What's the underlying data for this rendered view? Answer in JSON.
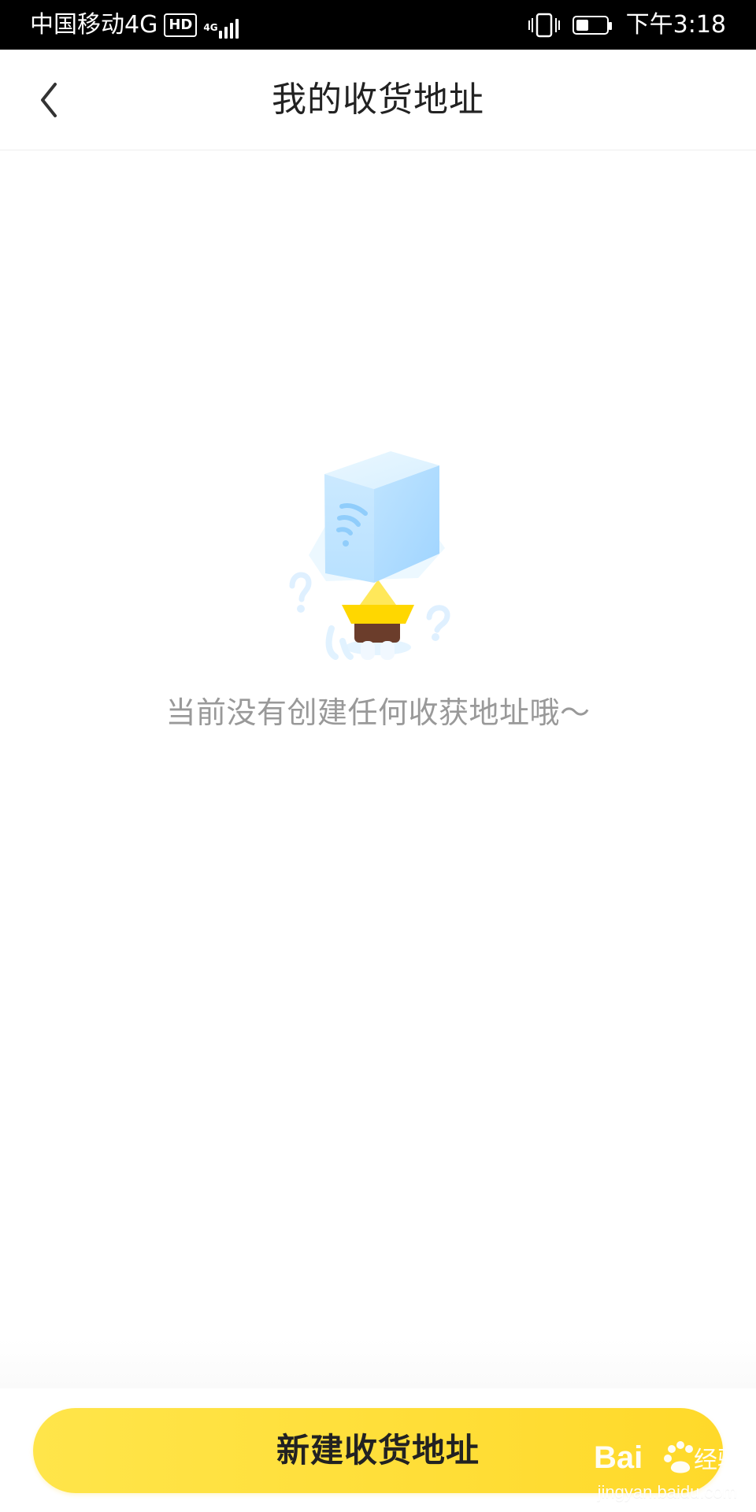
{
  "status_bar": {
    "carrier": "中国移动4G",
    "hd_badge": "HD",
    "network_tag": "4G",
    "time": "下午3:18",
    "battery_percent": 30
  },
  "nav": {
    "back_icon": "chevron-left-icon",
    "title": "我的收货地址"
  },
  "empty_state": {
    "illustration": "empty-box-character-icon",
    "message": "当前没有创建任何收获地址哦～"
  },
  "bottom": {
    "primary_button_label": "新建收货地址"
  },
  "watermark": {
    "logo_text": "Baidu经验",
    "url": "jingyan.baidu.com"
  },
  "colors": {
    "accent_yellow": "#FFE033",
    "status_bar_bg": "#000000",
    "title_text": "#222222",
    "empty_text": "#999999"
  }
}
